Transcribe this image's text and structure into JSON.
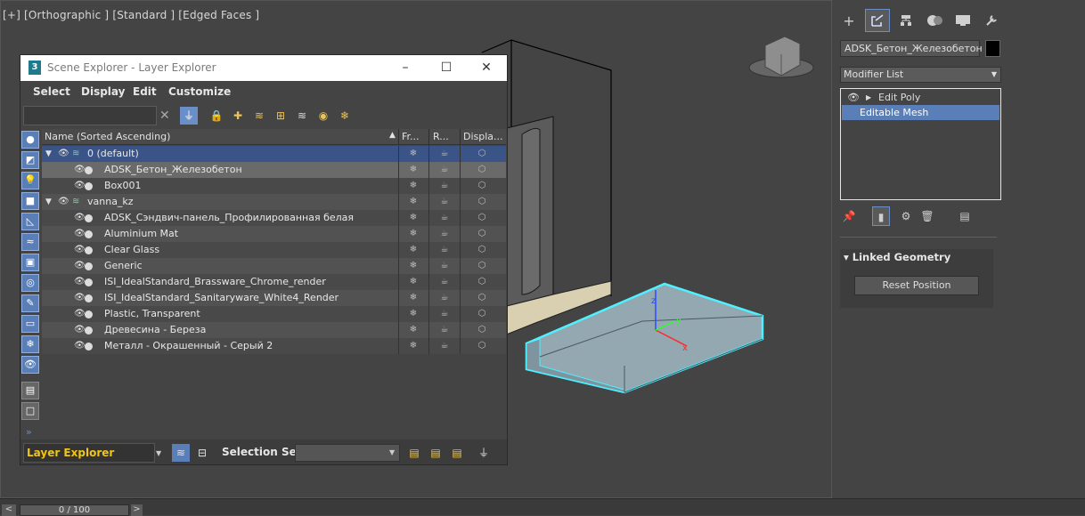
{
  "viewport": {
    "label": "[+] [Orthographic ] [Standard ] [Edged Faces ]"
  },
  "timeline": {
    "frame_label": "0 / 100",
    "prev": "<",
    "next": ">"
  },
  "command_panel": {
    "tabs": [
      "create-icon",
      "modify-icon",
      "hierarchy-icon",
      "motion-icon",
      "display-icon",
      "utilities-icon"
    ],
    "object_name": "ADSK_Бетон_Железобетон",
    "object_color": "#000000",
    "modifier_list": "Modifier List",
    "stack": [
      {
        "label": "Edit Poly"
      },
      {
        "label": "Editable Mesh",
        "selected": true
      }
    ],
    "rollout_title": "Linked Geometry",
    "reset_button": "Reset Position"
  },
  "scene_explorer": {
    "title": "Scene Explorer - Layer Explorer",
    "app_icon": "3",
    "menu": [
      "Select",
      "Display",
      "Edit",
      "Customize"
    ],
    "search_placeholder": "",
    "columns": {
      "name": "Name (Sorted Ascending)",
      "freeze": "Fr...",
      "render": "R...",
      "display": "Displa..."
    },
    "rows": [
      {
        "label": "0 (default)",
        "type": "layer",
        "level": 0
      },
      {
        "label": "ADSK_Бетон_Железобетон",
        "type": "object",
        "level": 1
      },
      {
        "label": "Box001",
        "type": "object",
        "level": 1
      },
      {
        "label": "vanna_kz",
        "type": "layer",
        "level": 0
      },
      {
        "label": "ADSK_Сэндвич-панель_Профилированная белая",
        "type": "object",
        "level": 1
      },
      {
        "label": "Aluminium Mat",
        "type": "object",
        "level": 1
      },
      {
        "label": "Clear Glass",
        "type": "object",
        "level": 1
      },
      {
        "label": "Generic",
        "type": "object",
        "level": 1
      },
      {
        "label": "ISI_IdealStandard_Brassware_Chrome_render",
        "type": "object",
        "level": 1
      },
      {
        "label": "ISI_IdealStandard_Sanitaryware_White4_Render",
        "type": "object",
        "level": 1
      },
      {
        "label": "Plastic, Transparent",
        "type": "object",
        "level": 1
      },
      {
        "label": "Древесина - Береза",
        "type": "object",
        "level": 1
      },
      {
        "label": "Металл - Окрашенный - Серый 2",
        "type": "object",
        "level": 1
      }
    ],
    "explorer_select": "Layer Explorer",
    "selection_set_label": "Selection Set:",
    "selection_set_value": ""
  },
  "colors": {
    "accent": "#5a7fb8",
    "selection": "#3a5488",
    "highlight_cyan": "#4ff0ff",
    "explorer_label": "#f0c419"
  }
}
